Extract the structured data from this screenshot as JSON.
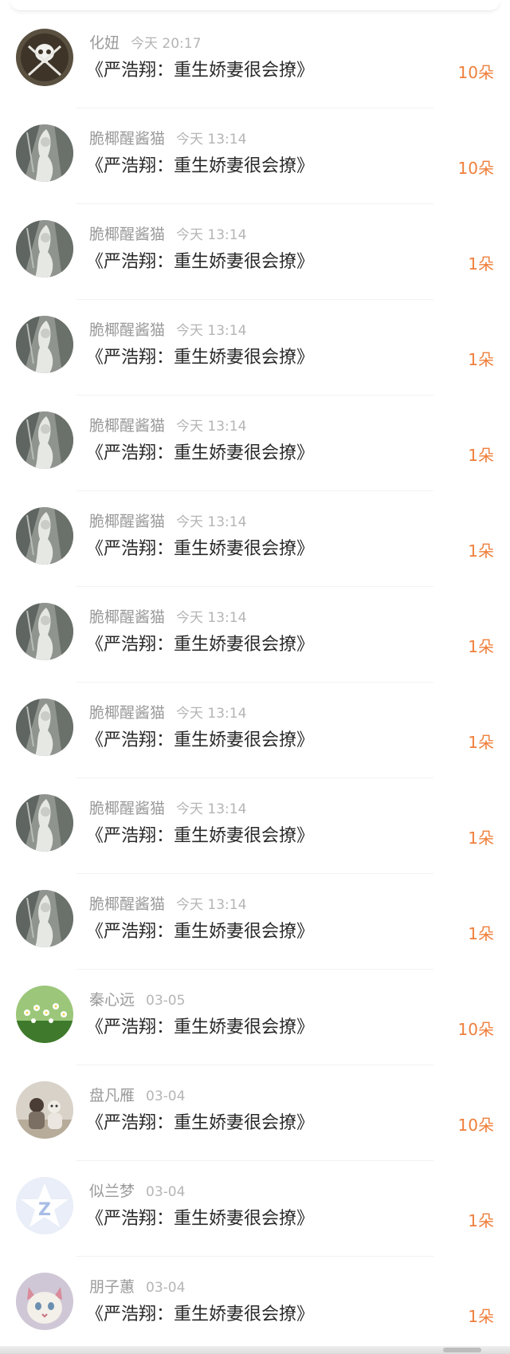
{
  "colors": {
    "amount": "#ef7f3b",
    "name": "#9a9a9a",
    "time": "#b5b5b5",
    "title": "#2a2a2a",
    "divider": "#f2f2f2"
  },
  "gifts": [
    {
      "name": "化妞",
      "time": "今天 20:17",
      "title": "《严浩翔：重生娇妻很会撩》",
      "amount": "10朵",
      "avatar": "pirate-flag"
    },
    {
      "name": "脆椰醒酱猫",
      "time": "今天 13:14",
      "title": "《严浩翔：重生娇妻很会撩》",
      "amount": "10朵",
      "avatar": "photo-person-bw"
    },
    {
      "name": "脆椰醒酱猫",
      "time": "今天 13:14",
      "title": "《严浩翔：重生娇妻很会撩》",
      "amount": "1朵",
      "avatar": "photo-person-bw"
    },
    {
      "name": "脆椰醒酱猫",
      "time": "今天 13:14",
      "title": "《严浩翔：重生娇妻很会撩》",
      "amount": "1朵",
      "avatar": "photo-person-bw"
    },
    {
      "name": "脆椰醒酱猫",
      "time": "今天 13:14",
      "title": "《严浩翔：重生娇妻很会撩》",
      "amount": "1朵",
      "avatar": "photo-person-bw"
    },
    {
      "name": "脆椰醒酱猫",
      "time": "今天 13:14",
      "title": "《严浩翔：重生娇妻很会撩》",
      "amount": "1朵",
      "avatar": "photo-person-bw"
    },
    {
      "name": "脆椰醒酱猫",
      "time": "今天 13:14",
      "title": "《严浩翔：重生娇妻很会撩》",
      "amount": "1朵",
      "avatar": "photo-person-bw"
    },
    {
      "name": "脆椰醒酱猫",
      "time": "今天 13:14",
      "title": "《严浩翔：重生娇妻很会撩》",
      "amount": "1朵",
      "avatar": "photo-person-bw"
    },
    {
      "name": "脆椰醒酱猫",
      "time": "今天 13:14",
      "title": "《严浩翔：重生娇妻很会撩》",
      "amount": "1朵",
      "avatar": "photo-person-bw"
    },
    {
      "name": "脆椰醒酱猫",
      "time": "今天 13:14",
      "title": "《严浩翔：重生娇妻很会撩》",
      "amount": "1朵",
      "avatar": "photo-person-bw"
    },
    {
      "name": "秦心远",
      "time": "03-05",
      "title": "《严浩翔：重生娇妻很会撩》",
      "amount": "10朵",
      "avatar": "photo-flowers"
    },
    {
      "name": "盘凡雁",
      "time": "03-04",
      "title": "《严浩翔：重生娇妻很会撩》",
      "amount": "10朵",
      "avatar": "photo-couple"
    },
    {
      "name": "似兰梦",
      "time": "03-04",
      "title": "《严浩翔：重生娇妻很会撩》",
      "amount": "1朵",
      "avatar": "qzone-star-logo"
    },
    {
      "name": "朋子蕙",
      "time": "03-04",
      "title": "《严浩翔：重生娇妻很会撩》",
      "amount": "1朵",
      "avatar": "photo-cat"
    }
  ]
}
